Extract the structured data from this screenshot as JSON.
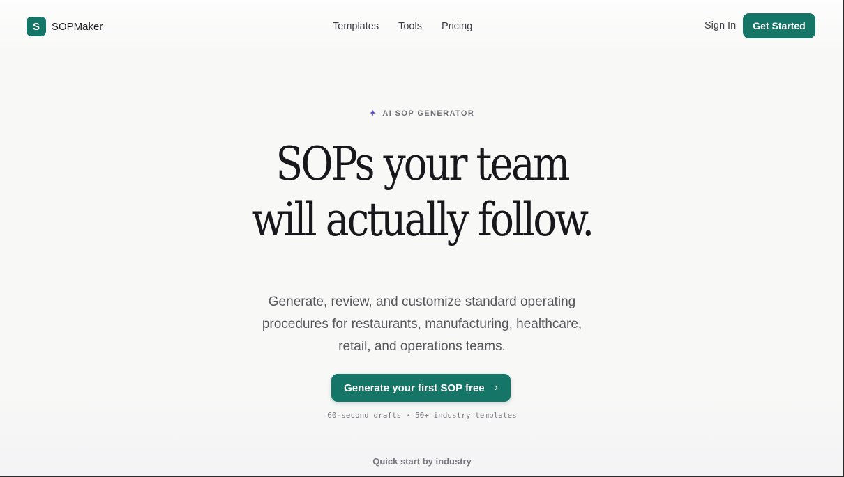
{
  "brand": {
    "logo_letter": "S",
    "name": "SOPMaker",
    "accent": "#157566"
  },
  "nav": {
    "items": [
      {
        "label": "Templates"
      },
      {
        "label": "Tools"
      },
      {
        "label": "Pricing"
      }
    ]
  },
  "auth": {
    "sign_in": "Sign In",
    "get_started": "Get Started"
  },
  "hero": {
    "eyebrow_icon": "sparkle-icon",
    "eyebrow_glyph": "✦",
    "eyebrow": "AI SOP GENERATOR",
    "headline_line1": "SOPs your team",
    "headline_line2": "will actually follow.",
    "subtitle": "Generate, review, and customize standard operating procedures for restaurants, manufacturing, healthcare, retail, and operations teams.",
    "cta_label": "Generate your first SOP free",
    "cta_icon": "chevron-right-icon",
    "cta_glyph": "›",
    "meta": "60-second drafts · 50+ industry templates"
  },
  "quick_start": {
    "label": "Quick start by industry"
  }
}
